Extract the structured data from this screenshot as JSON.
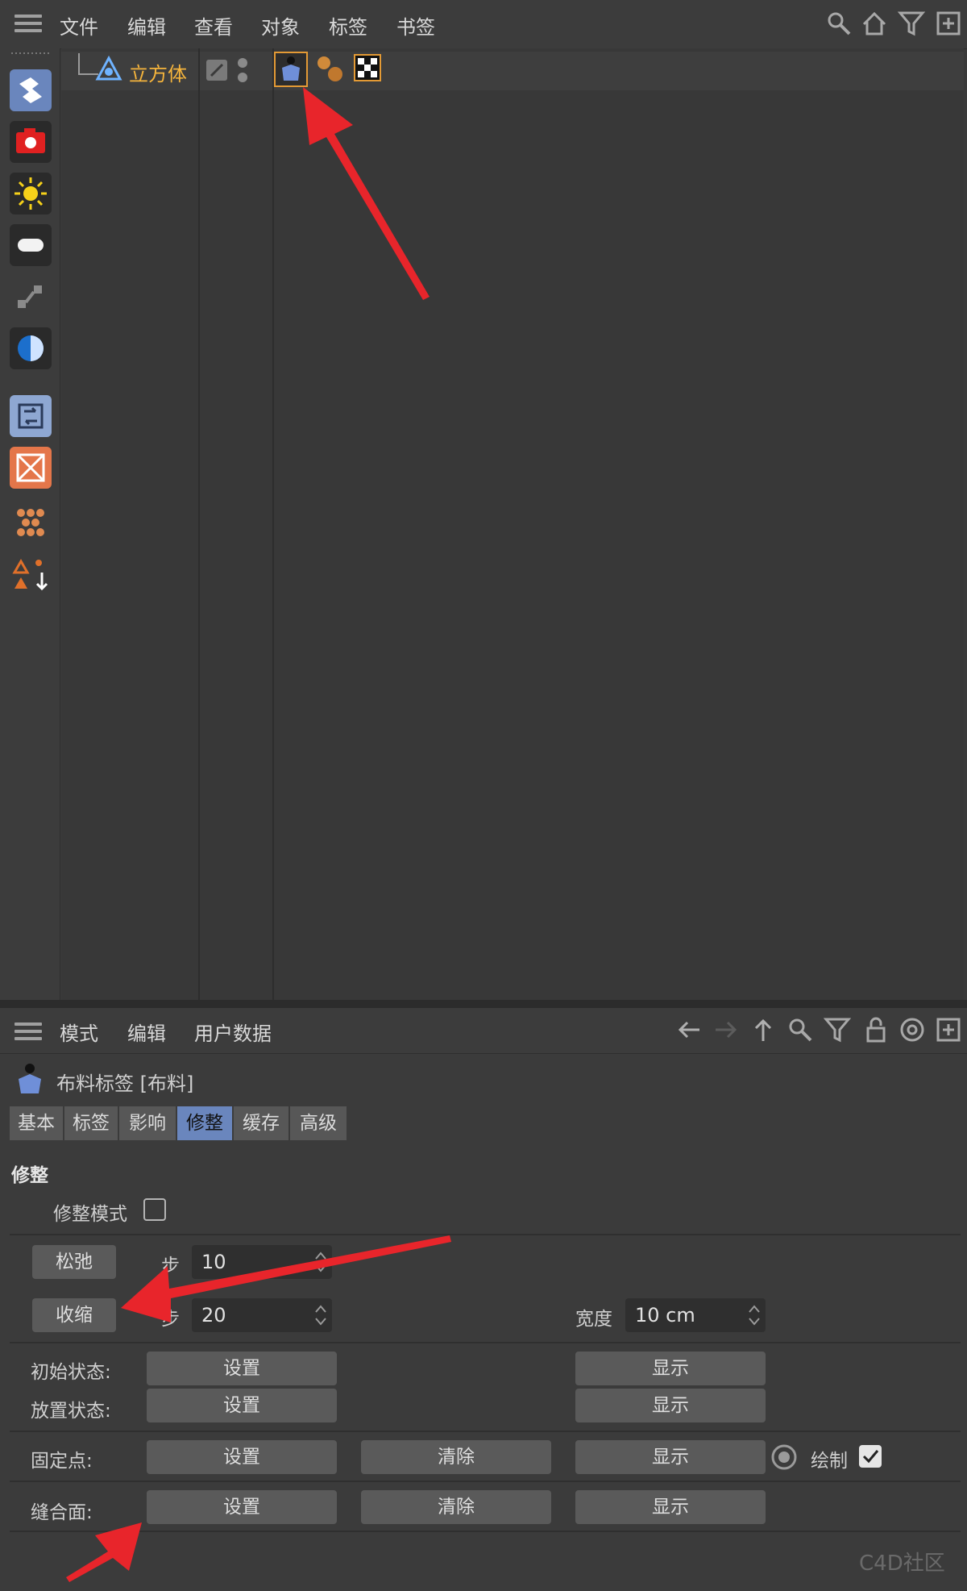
{
  "object_manager": {
    "menu": [
      "文件",
      "编辑",
      "查看",
      "对象",
      "标签",
      "书签"
    ],
    "object_name": "立方体",
    "left_toolbar_icons": [
      "cloth-simulation-icon",
      "camera-icon",
      "light-icon",
      "sky-icon",
      "spline-icon",
      "background-icon",
      "dynamics-icon",
      "deformer-icon",
      "mograph-icon",
      "hair-icon"
    ],
    "tags": [
      "cloth-tag-icon",
      "material-tag-icon",
      "checker-tag-icon"
    ],
    "header_icons": [
      "search-icon",
      "home-icon",
      "filter-icon",
      "new-window-icon"
    ]
  },
  "attribute_manager": {
    "menu": [
      "模式",
      "编辑",
      "用户数据"
    ],
    "nav_icons": [
      "arrow-left-icon",
      "arrow-right-icon",
      "arrow-up-icon",
      "search-icon",
      "filter-icon",
      "lock-icon",
      "target-icon",
      "new-window-icon"
    ],
    "title": "布料标签 [布料]",
    "tabs": [
      "基本",
      "标签",
      "影响",
      "修整",
      "缓存",
      "高级"
    ],
    "active_tab": "修整",
    "section_title": "修整",
    "dress_mode_label": "修整模式",
    "relax_button": "松弛",
    "relax_steps_label": "步",
    "relax_steps": "10",
    "shrink_button": "收缩",
    "shrink_steps_label": "步",
    "shrink_steps": "20",
    "width_label": "宽度",
    "width_value": "10 cm",
    "init_state_label": "初始状态:",
    "dress_state_label": "放置状态:",
    "fix_points_label": "固定点:",
    "seam_polys_label": "缝合面:",
    "set_label": "设置",
    "clear_label": "清除",
    "show_label": "显示",
    "draw_label": "绘制",
    "draw_checked": true
  },
  "watermark": "C4D社区",
  "colors": {
    "accent": "#6a86bd",
    "object_name": "#f5b43c",
    "annotation_arrow": "#e8252b"
  }
}
